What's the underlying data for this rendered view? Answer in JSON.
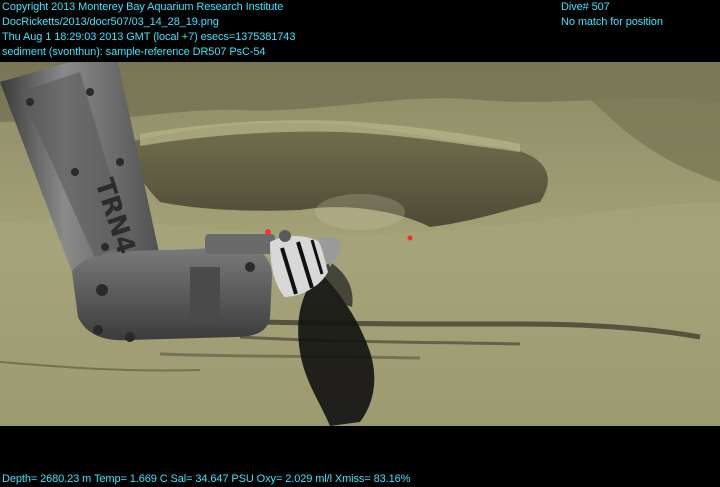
{
  "header": {
    "line1": "Copyright 2013 Monterey Bay Aquarium Research Institute",
    "line2": "DocRicketts/2013/docr507/03_14_28_19.png",
    "line3": "Thu Aug  1 18:29:03 2013 GMT (local +7)  esecs=1375381743",
    "line4": "sediment (svonthun): sample-reference DR507 PsC-54",
    "dive": "Dive# 507",
    "position_status": "No match for position"
  },
  "footer": {
    "telemetry": "Depth= 2680.23 m  Temp= 1.669 C  Sal= 34.647 PSU  Oxy= 2.029 ml/l  Xmiss= 83.16%"
  },
  "scene": {
    "arm_label": "TRN4",
    "colors": {
      "sediment": "#9c9a6e",
      "sediment_dark": "#4d4b35",
      "arm_metal": "#6b6b6b",
      "overlay_text": "#35e6ff"
    },
    "icons": [
      "manipulator-arm",
      "sampling-scoop",
      "laser-dot"
    ]
  }
}
